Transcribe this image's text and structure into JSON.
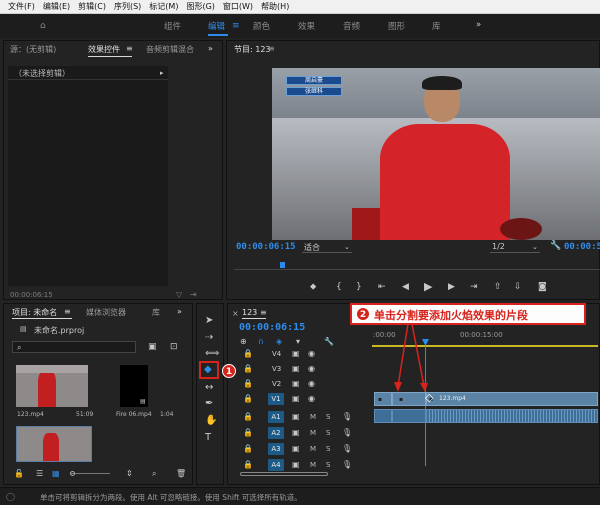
{
  "menu": [
    "文件(F)",
    "编辑(E)",
    "剪辑(C)",
    "序列(S)",
    "标记(M)",
    "图形(G)",
    "窗口(W)",
    "帮助(H)"
  ],
  "workspaces": {
    "items": [
      "组件",
      "编辑",
      "颜色",
      "效果",
      "音频",
      "图形",
      "库"
    ],
    "active": "编辑",
    "more": "»"
  },
  "source_panel": {
    "tabs": [
      "源：(无剪辑)",
      "效果控件",
      "音频剪辑混合"
    ],
    "dropdown": "（未选择剪辑）",
    "timecode": "00:00:06:15",
    "more": "»"
  },
  "program_panel": {
    "title": "节目: 123",
    "menu_icon": "≡",
    "overlay_names": [
      "周启豪",
      "张继科"
    ],
    "timecode": "00:00:06:15",
    "fit": "适合",
    "resolution": "1/2",
    "end_timecode": "00:00:5"
  },
  "project_panel": {
    "tabs": [
      "项目: 未命名",
      "媒体浏览器",
      "库"
    ],
    "file": "未命名.prproj",
    "items": [
      {
        "name": "123.mp4",
        "duration": "51:09"
      },
      {
        "name": "Fire 06.mp4",
        "duration": "1:04"
      }
    ],
    "more": "»"
  },
  "timeline": {
    "title": "123",
    "timecode": "00:00:06:15",
    "ruler": [
      ":00:00",
      "00:00:15:00"
    ],
    "video_tracks": [
      "V4",
      "V3",
      "V2",
      "V1"
    ],
    "audio_tracks": [
      "A1",
      "A2",
      "A3",
      "A4"
    ],
    "clip_label": "123.mp4"
  },
  "annotations": {
    "step1": "1",
    "step2": "2",
    "step2_text": "单击分割要添加火焰效果的片段"
  },
  "status_bar": "单击可将剪辑拆分为两段。使用 Alt 可忽略链接。使用 Shift 可选择所有轨道。",
  "colors": {
    "accent": "#2d8ceb",
    "annotation": "#d8231c",
    "clip_video": "#5a83a6",
    "clip_audio": "#3f6f98"
  }
}
